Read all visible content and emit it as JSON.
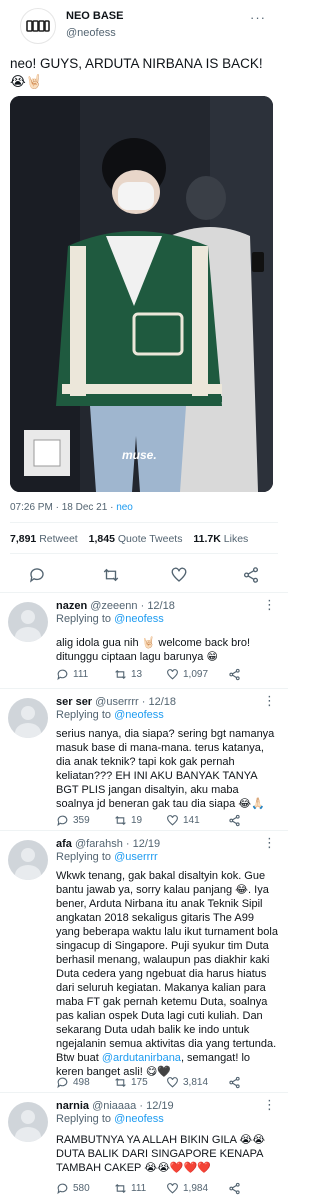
{
  "tweet": {
    "display_name": "NEO BASE",
    "handle": "@neofess",
    "more_icon": "ellipsis-icon",
    "text": "neo! GUYS, ARDUTA NIRBANA IS BACK! 😭🤘🏻",
    "media_watermark": "muse.",
    "time": "07:26 PM",
    "date": "18 Dec 21",
    "source": "neo",
    "retweets": "7,891",
    "retweets_label": "Retweet",
    "quote_tweets": "1,845",
    "quote_tweets_label": "Quote Tweets",
    "likes": "11.7K",
    "likes_label": "Likes"
  },
  "replies": [
    {
      "name": "nazen",
      "handle": "@zeeenn",
      "date": "12/18",
      "replying_label": "Replying to",
      "replying_to": "@neofess",
      "text": "alig idola gua nih 🤘🏻 welcome back bro! ditunggu ciptaan lagu barunya 😁",
      "reply_count": "111",
      "retweet_count": "13",
      "like_count": "1,097"
    },
    {
      "name": "ser ser",
      "handle": "@userrrr",
      "date": "12/18",
      "replying_label": "Replying to",
      "replying_to": "@neofess",
      "text": "serius nanya, dia siapa? sering bgt namanya masuk base di mana-mana. terus katanya, dia anak teknik? tapi kok gak pernah keliatan??? EH INI AKU BANYAK TANYA BGT PLIS jangan disaltyin, aku maba soalnya jd beneran gak tau dia siapa 😂🙏🏻",
      "reply_count": "359",
      "retweet_count": "19",
      "like_count": "141"
    },
    {
      "name": "afa",
      "handle": "@farahsh",
      "date": "12/19",
      "replying_label": "Replying to",
      "replying_to": "@userrrr",
      "text": "Wkwk tenang, gak bakal disaltyin kok. Gue bantu jawab ya, sorry kalau panjang 😂. Iya bener, Arduta Nirbana itu anak Teknik Sipil angkatan 2018 sekaligus gitaris The A99 yang beberapa waktu lalu ikut turnament bola singacup di Singapore. Puji syukur tim Duta berhasil menang, walaupun pas diakhir kaki Duta cedera yang ngebuat dia harus hiatus dari seluruh kegiatan. Makanya kalian para maba FT gak pernah ketemu Duta, soalnya pas kalian ospek Duta lagi cuti kuliah. Dan sekarang Duta udah balik ke indo untuk ngejalanin semua aktivitas dia yang tertunda. Btw buat",
      "mention": "@ardutanirbana",
      "text_end": ", semangat! lo keren banget asli! 😋🖤",
      "reply_count": "498",
      "retweet_count": "175",
      "like_count": "3,814"
    },
    {
      "name": "narnia",
      "handle": "@niaaaa",
      "date": "12/19",
      "replying_label": "Replying to",
      "replying_to": "@neofess",
      "text": "RAMBUTNYA YA ALLAH BIKIN GILA 😭😭 DUTA BALIK DARI SINGAPORE KENAPA TAMBAH CAKEP 😭😭❤️❤️❤️",
      "reply_count": "580",
      "retweet_count": "111",
      "like_count": "1,984"
    }
  ],
  "colors": {
    "link": "#1d9bf0",
    "text": "#0f1419",
    "muted": "#536471",
    "divider": "#eff3f4"
  }
}
